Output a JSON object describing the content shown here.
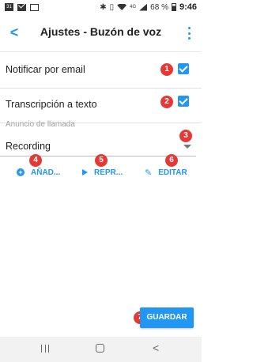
{
  "status_bar": {
    "calendar_day": "31",
    "lte": "4G",
    "battery": "68 %",
    "time": "9:46",
    "icons": [
      "calendar-icon",
      "mail-icon",
      "image-icon",
      "bluetooth-icon",
      "vibrate-icon",
      "wifi-icon",
      "signal-icon",
      "battery-icon"
    ]
  },
  "app_bar": {
    "back_glyph": "<",
    "title": "Ajustes - Buzón de voz",
    "menu_icon": "more-vert-icon"
  },
  "settings": {
    "notify_email": {
      "label": "Notificar por email",
      "checked": true,
      "badge": "1"
    },
    "transcription": {
      "label": "Transcripción a texto",
      "checked": true,
      "badge": "2"
    },
    "announcement": {
      "label": "Anuncio de llamada",
      "value": "Recording",
      "badge": "3"
    }
  },
  "actions": {
    "add": {
      "label": "AÑAD...",
      "badge": "4",
      "icon": "add-circle-icon"
    },
    "play": {
      "label": "REPR...",
      "badge": "5",
      "icon": "play-icon"
    },
    "edit": {
      "label": "EDITAR",
      "badge": "6",
      "icon": "edit-icon"
    }
  },
  "save": {
    "label": "GUARDAR",
    "badge": "7"
  },
  "nav": {
    "back_glyph": "<"
  },
  "colors": {
    "accent": "#2196f3",
    "badge": "#e53935"
  }
}
